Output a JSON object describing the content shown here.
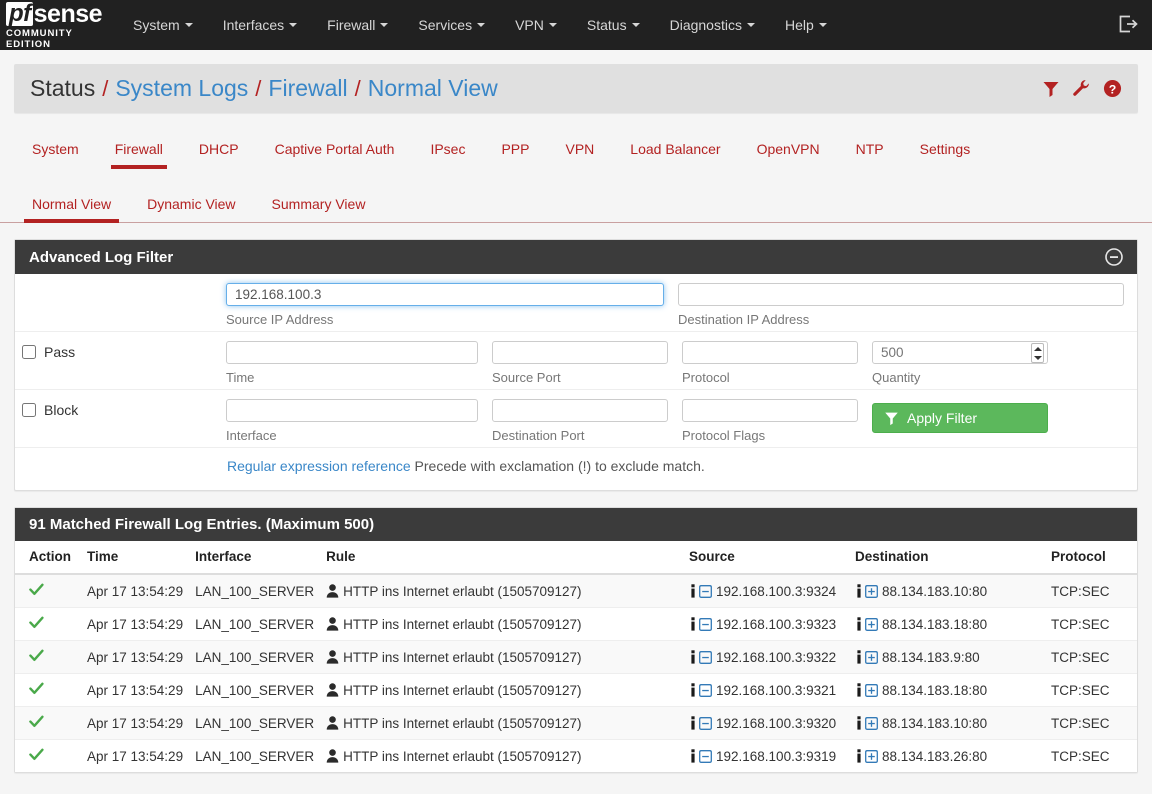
{
  "navbar": {
    "brand": {
      "logo_pf": "pf",
      "logo_sense": "sense",
      "subtitle": "COMMUNITY EDITION"
    },
    "items": [
      {
        "label": "System",
        "has_caret": true
      },
      {
        "label": "Interfaces",
        "has_caret": true
      },
      {
        "label": "Firewall",
        "has_caret": true
      },
      {
        "label": "Services",
        "has_caret": true
      },
      {
        "label": "VPN",
        "has_caret": true
      },
      {
        "label": "Status",
        "has_caret": true
      },
      {
        "label": "Diagnostics",
        "has_caret": true
      },
      {
        "label": "Help",
        "has_caret": true
      }
    ],
    "logout_icon": "logout-icon"
  },
  "breadcrumb": {
    "items": [
      "Status",
      "System Logs",
      "Firewall",
      "Normal View"
    ],
    "separator": "/",
    "icons": [
      "filter-icon",
      "wrench-icon",
      "help-circle-icon"
    ],
    "icon_color": "#b32222"
  },
  "tabs_primary": {
    "items": [
      {
        "label": "System",
        "active": false
      },
      {
        "label": "Firewall",
        "active": true
      },
      {
        "label": "DHCP",
        "active": false
      },
      {
        "label": "Captive Portal Auth",
        "active": false
      },
      {
        "label": "IPsec",
        "active": false
      },
      {
        "label": "PPP",
        "active": false
      },
      {
        "label": "VPN",
        "active": false
      },
      {
        "label": "Load Balancer",
        "active": false
      },
      {
        "label": "OpenVPN",
        "active": false
      },
      {
        "label": "NTP",
        "active": false
      },
      {
        "label": "Settings",
        "active": false
      }
    ],
    "accent": "#b32222"
  },
  "tabs_secondary": {
    "items": [
      {
        "label": "Normal View",
        "active": true
      },
      {
        "label": "Dynamic View",
        "active": false
      },
      {
        "label": "Summary View",
        "active": false
      }
    ]
  },
  "filter_panel": {
    "title": "Advanced Log Filter",
    "collapse_icon": "minus-circle-icon",
    "source_ip": {
      "value": "192.168.100.3",
      "label": "Source IP Address",
      "focused": true
    },
    "destination_ip": {
      "value": "",
      "label": "Destination IP Address"
    },
    "pass": {
      "label": "Pass",
      "checked": false
    },
    "block": {
      "label": "Block",
      "checked": false
    },
    "time": {
      "value": "",
      "label": "Time"
    },
    "source_port": {
      "value": "",
      "label": "Source Port"
    },
    "protocol": {
      "value": "",
      "label": "Protocol"
    },
    "quantity": {
      "value": "",
      "placeholder": "500",
      "label": "Quantity"
    },
    "interface": {
      "value": "",
      "label": "Interface"
    },
    "destination_port": {
      "value": "",
      "label": "Destination Port"
    },
    "protocol_flags": {
      "value": "",
      "label": "Protocol Flags"
    },
    "apply_button": {
      "label": "Apply Filter",
      "icon": "filter-icon",
      "color": "#5cb85c"
    },
    "regex_link": "Regular expression reference",
    "regex_text": " Precede with exclamation (!) to exclude match."
  },
  "results_panel": {
    "title": "91 Matched Firewall Log Entries. (Maximum 500)",
    "headers": [
      "Action",
      "Time",
      "Interface",
      "Rule",
      "Source",
      "Destination",
      "Protocol"
    ],
    "rows": [
      {
        "action": "pass",
        "action_icon": "check-icon",
        "time": "Apr 17 13:54:29",
        "interface": "LAN_100_SERVER",
        "rule": "HTTP ins Internet erlaubt (1505709127)",
        "rule_icon": "user-icon",
        "source": "192.168.100.3:9324",
        "destination": "88.134.183.10:80",
        "protocol": "TCP:SEC"
      },
      {
        "action": "pass",
        "action_icon": "check-icon",
        "time": "Apr 17 13:54:29",
        "interface": "LAN_100_SERVER",
        "rule": "HTTP ins Internet erlaubt (1505709127)",
        "rule_icon": "user-icon",
        "source": "192.168.100.3:9323",
        "destination": "88.134.183.18:80",
        "protocol": "TCP:SEC"
      },
      {
        "action": "pass",
        "action_icon": "check-icon",
        "time": "Apr 17 13:54:29",
        "interface": "LAN_100_SERVER",
        "rule": "HTTP ins Internet erlaubt (1505709127)",
        "rule_icon": "user-icon",
        "source": "192.168.100.3:9322",
        "destination": "88.134.183.9:80",
        "protocol": "TCP:SEC"
      },
      {
        "action": "pass",
        "action_icon": "check-icon",
        "time": "Apr 17 13:54:29",
        "interface": "LAN_100_SERVER",
        "rule": "HTTP ins Internet erlaubt (1505709127)",
        "rule_icon": "user-icon",
        "source": "192.168.100.3:9321",
        "destination": "88.134.183.18:80",
        "protocol": "TCP:SEC"
      },
      {
        "action": "pass",
        "action_icon": "check-icon",
        "time": "Apr 17 13:54:29",
        "interface": "LAN_100_SERVER",
        "rule": "HTTP ins Internet erlaubt (1505709127)",
        "rule_icon": "user-icon",
        "source": "192.168.100.3:9320",
        "destination": "88.134.183.10:80",
        "protocol": "TCP:SEC"
      },
      {
        "action": "pass",
        "action_icon": "check-icon",
        "time": "Apr 17 13:54:29",
        "interface": "LAN_100_SERVER",
        "rule": "HTTP ins Internet erlaubt (1505709127)",
        "rule_icon": "user-icon",
        "source": "192.168.100.3:9319",
        "destination": "88.134.183.26:80",
        "protocol": "TCP:SEC"
      }
    ],
    "source_icons": [
      "info-icon",
      "minus-square-icon"
    ],
    "destination_icons": [
      "info-icon",
      "plus-square-icon"
    ]
  }
}
